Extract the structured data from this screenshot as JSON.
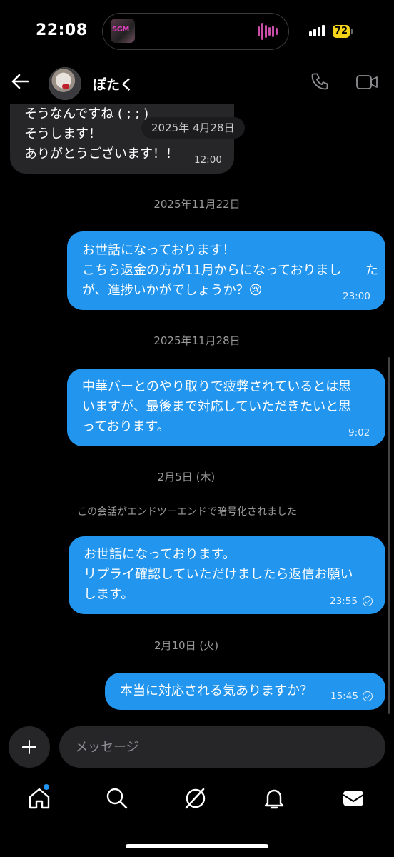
{
  "status_bar": {
    "time": "22:08",
    "battery": "72",
    "now_playing_art_text": "SGM"
  },
  "header": {
    "contact_name": "ぽたく"
  },
  "messages": {
    "incoming": {
      "lines": [
        "そうなんですね ( ; ; )",
        "そうします！",
        "ありがとうございます！！"
      ],
      "time": "12:00"
    },
    "floating_date": "2025年 4月28日",
    "dates": [
      "2025年11月22日",
      "2025年11月28日",
      "2月5日 (木)",
      "2月10日 (火)"
    ],
    "outgoing": [
      {
        "lines": [
          "お世話になっております！",
          "こちら返金の方が11月からになっておりまし",
          "た",
          "が、進捗いかがでしょうか？😢"
        ],
        "time": "23:00"
      },
      {
        "lines": [
          "中華バーとのやり取りで疲弊されているとは思",
          "いますが、最後まで対応していただきたいと思",
          "っております。"
        ],
        "time": "9:02"
      },
      {
        "lines": [
          "お世話になっております。",
          "リプライ確認していただけましたら返信お願い",
          "します。"
        ],
        "time": "23:55"
      },
      {
        "lines": [
          "本当に対応される気ありますか？"
        ],
        "time": "15:45"
      }
    ],
    "e2e_notice": "この会話がエンドツーエンドで暗号化されました"
  },
  "composer": {
    "placeholder": "メッセージ"
  },
  "icons": {
    "back": "arrow-left-icon",
    "call": "phone-icon",
    "video": "video-camera-icon",
    "plus": "plus-icon",
    "home": "home-icon",
    "search": "search-icon",
    "explore": "compass-icon",
    "notifications": "bell-icon",
    "messages": "envelope-icon"
  },
  "colors": {
    "outgoing_bubble": "#2295ee",
    "incoming_bubble": "#262628",
    "background": "#000000",
    "unread_dot": "#2295ee"
  }
}
